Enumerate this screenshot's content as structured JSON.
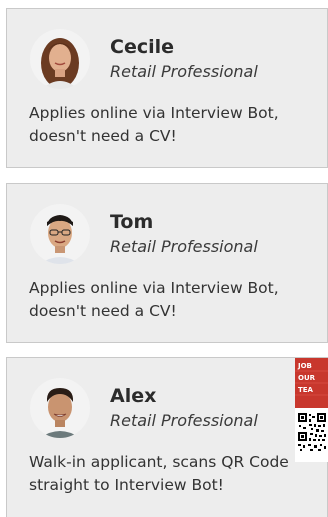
{
  "cards": [
    {
      "name": "Cecile",
      "role": "Retail Professional",
      "description": "Applies online via Interview Bot, doesn't need a CV!"
    },
    {
      "name": "Tom",
      "role": "Retail Professional",
      "description": "Applies online via Interview Bot, doesn't need a CV!"
    },
    {
      "name": "Alex",
      "role": "Retail Professional",
      "description": "Walk-in applicant, scans QR Code straight to Interview Bot!"
    }
  ],
  "poster": {
    "text_rows": [
      "JOB",
      "OUR",
      "TEA"
    ],
    "accent_color": "#c8372d"
  },
  "colors": {
    "card_bg": "#ededed",
    "card_border": "#c9c9c9"
  }
}
